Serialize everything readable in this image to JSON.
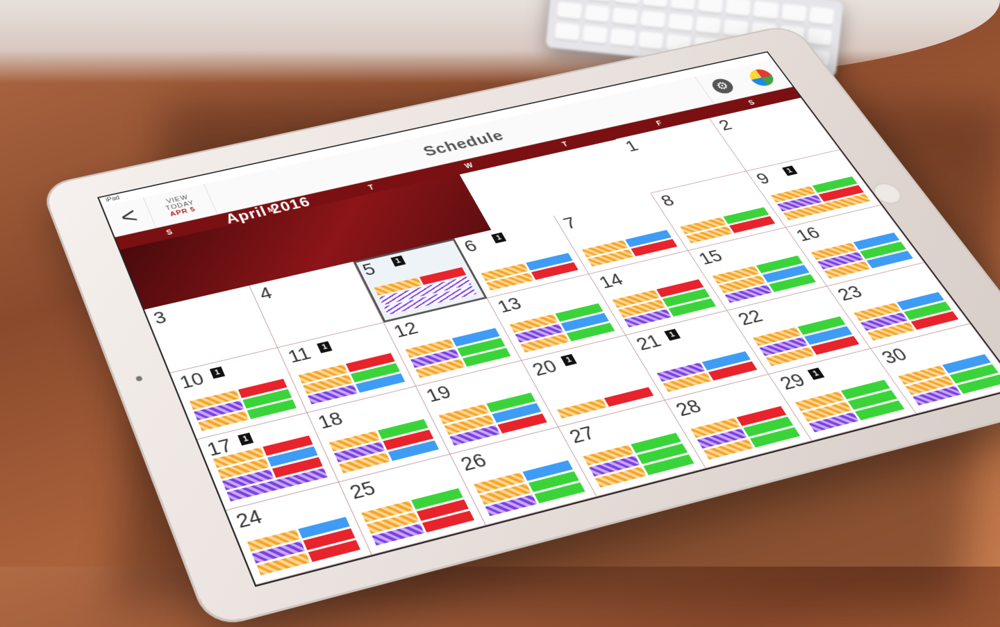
{
  "device": {
    "status_left": "iPad"
  },
  "navbar": {
    "back_glyph": "<",
    "today_line1": "VIEW",
    "today_line2": "TODAY",
    "today_date": "APR 5",
    "title": "Schedule",
    "settings_icon": "gear-icon",
    "palette_icon": "palette-icon"
  },
  "calendar": {
    "month_title": "April 2016",
    "weekdays": [
      "S",
      "M",
      "T",
      "W",
      "T",
      "F",
      "S"
    ],
    "days": [
      {
        "day": "",
        "blocks": []
      },
      {
        "day": "",
        "blocks": []
      },
      {
        "day": "",
        "blocks": []
      },
      {
        "day": "",
        "blocks": []
      },
      {
        "day": "",
        "blocks": []
      },
      {
        "day": "1",
        "blocks": []
      },
      {
        "day": "2",
        "blocks": []
      },
      {
        "day": "3",
        "blocks": []
      },
      {
        "day": "4",
        "blocks": []
      },
      {
        "day": "5",
        "today": true,
        "badge": "1",
        "blocks": [
          [
            "orange",
            "red"
          ],
          [
            "lines"
          ],
          [
            "lines"
          ]
        ]
      },
      {
        "day": "6",
        "badge": "1",
        "blocks": [
          [
            "orange",
            "blue"
          ],
          [
            "orange",
            "red"
          ]
        ]
      },
      {
        "day": "7",
        "blocks": [
          [
            "orange",
            "blue"
          ],
          [
            "orange",
            "red"
          ]
        ]
      },
      {
        "day": "8",
        "blocks": [
          [
            "orange",
            "green"
          ],
          [
            "orange",
            "red"
          ]
        ]
      },
      {
        "day": "9",
        "badge": "1",
        "blocks": [
          [
            "orange",
            "green"
          ],
          [
            "purple",
            "red"
          ],
          [
            "orange"
          ]
        ]
      },
      {
        "day": "10",
        "badge": "1",
        "blocks": [
          [
            "orange",
            "red"
          ],
          [
            "purple",
            "green"
          ],
          [
            "orange",
            "green"
          ]
        ]
      },
      {
        "day": "11",
        "badge": "1",
        "blocks": [
          [
            "orange",
            "red"
          ],
          [
            "orange",
            "green"
          ],
          [
            "purple",
            "blue"
          ]
        ]
      },
      {
        "day": "12",
        "blocks": [
          [
            "orange",
            "blue"
          ],
          [
            "purple",
            "green"
          ],
          [
            "orange",
            "green"
          ]
        ]
      },
      {
        "day": "13",
        "blocks": [
          [
            "orange",
            "green"
          ],
          [
            "purple",
            "blue"
          ],
          [
            "orange",
            "green"
          ]
        ]
      },
      {
        "day": "14",
        "blocks": [
          [
            "orange",
            "red"
          ],
          [
            "orange",
            "green"
          ],
          [
            "purple",
            "green"
          ]
        ]
      },
      {
        "day": "15",
        "blocks": [
          [
            "orange",
            "green"
          ],
          [
            "orange",
            "blue"
          ],
          [
            "purple",
            "green"
          ]
        ]
      },
      {
        "day": "16",
        "blocks": [
          [
            "orange",
            "blue"
          ],
          [
            "purple",
            "green"
          ],
          [
            "orange",
            "blue"
          ]
        ]
      },
      {
        "day": "17",
        "badge": "1",
        "blocks": [
          [
            "orange",
            "red"
          ],
          [
            "orange",
            "blue"
          ],
          [
            "purple",
            "red"
          ],
          [
            "purple"
          ]
        ]
      },
      {
        "day": "18",
        "blocks": [
          [
            "orange",
            "green"
          ],
          [
            "purple",
            "red"
          ],
          [
            "orange",
            "blue"
          ]
        ]
      },
      {
        "day": "19",
        "blocks": [
          [
            "orange",
            "green"
          ],
          [
            "orange",
            "blue"
          ],
          [
            "purple",
            "red"
          ]
        ]
      },
      {
        "day": "20",
        "badge": "1",
        "blocks": [
          [
            "orange",
            "red"
          ]
        ]
      },
      {
        "day": "21",
        "badge": "1",
        "blocks": [
          [
            "purple",
            "blue"
          ],
          [
            "orange",
            "red"
          ]
        ]
      },
      {
        "day": "22",
        "blocks": [
          [
            "orange",
            "green"
          ],
          [
            "purple",
            "blue"
          ],
          [
            "orange",
            "red"
          ]
        ]
      },
      {
        "day": "23",
        "blocks": [
          [
            "orange",
            "blue"
          ],
          [
            "purple",
            "green"
          ],
          [
            "orange",
            "red"
          ]
        ]
      },
      {
        "day": "24",
        "blocks": [
          [
            "orange",
            "blue"
          ],
          [
            "purple",
            "red"
          ],
          [
            "orange",
            "red"
          ]
        ]
      },
      {
        "day": "25",
        "blocks": [
          [
            "orange",
            "green"
          ],
          [
            "orange",
            "red"
          ],
          [
            "purple",
            "red"
          ]
        ]
      },
      {
        "day": "26",
        "blocks": [
          [
            "orange",
            "blue"
          ],
          [
            "orange",
            "green"
          ],
          [
            "purple",
            "green"
          ]
        ]
      },
      {
        "day": "27",
        "blocks": [
          [
            "orange",
            "green"
          ],
          [
            "purple",
            "green"
          ],
          [
            "orange",
            "green"
          ]
        ]
      },
      {
        "day": "28",
        "blocks": [
          [
            "orange",
            "red"
          ],
          [
            "purple",
            "green"
          ],
          [
            "orange",
            "green"
          ]
        ]
      },
      {
        "day": "29",
        "badge": "1",
        "blocks": [
          [
            "orange",
            "green"
          ],
          [
            "orange",
            "green"
          ],
          [
            "purple",
            "green"
          ]
        ]
      },
      {
        "day": "30",
        "blocks": [
          [
            "orange",
            "blue"
          ],
          [
            "orange",
            "green"
          ],
          [
            "purple",
            "green"
          ]
        ]
      }
    ]
  },
  "colors": {
    "header_red": "#7a1012",
    "today_red": "#b71c1c",
    "block_red": "#e8232b",
    "block_green": "#3ad43a",
    "block_blue": "#3e9cf5",
    "block_orange": "#f5a623",
    "block_purple": "#7b3fe4"
  }
}
